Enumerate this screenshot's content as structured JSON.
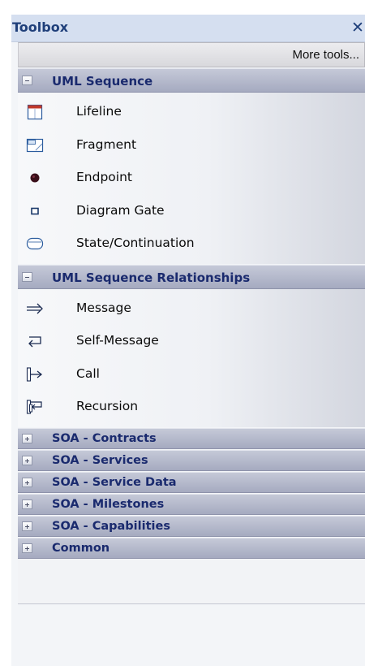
{
  "toolbox": {
    "title": "Toolbox",
    "close_glyph": "✕",
    "more_tools_label": "More tools..."
  },
  "categories": [
    {
      "label": "UML Sequence",
      "expanded": true,
      "items": [
        {
          "label": "Lifeline",
          "icon": "lifeline-icon"
        },
        {
          "label": "Fragment",
          "icon": "fragment-icon"
        },
        {
          "label": "Endpoint",
          "icon": "endpoint-icon"
        },
        {
          "label": "Diagram Gate",
          "icon": "diagram-gate-icon"
        },
        {
          "label": "State/Continuation",
          "icon": "state-continuation-icon"
        }
      ]
    },
    {
      "label": "UML Sequence Relationships",
      "expanded": true,
      "items": [
        {
          "label": "Message",
          "icon": "message-arrow-icon"
        },
        {
          "label": "Self-Message",
          "icon": "self-message-icon"
        },
        {
          "label": "Call",
          "icon": "call-icon"
        },
        {
          "label": "Recursion",
          "icon": "recursion-icon"
        }
      ]
    },
    {
      "label": "SOA - Contracts",
      "expanded": false
    },
    {
      "label": "SOA - Services",
      "expanded": false
    },
    {
      "label": "SOA - Service Data",
      "expanded": false
    },
    {
      "label": "SOA - Milestones",
      "expanded": false
    },
    {
      "label": "SOA - Capabilities",
      "expanded": false
    },
    {
      "label": "Common",
      "expanded": false
    }
  ],
  "colors": {
    "title_text": "#1f3f7a",
    "category_text": "#1a2a6e",
    "category_bg": "#b4b8cc"
  }
}
